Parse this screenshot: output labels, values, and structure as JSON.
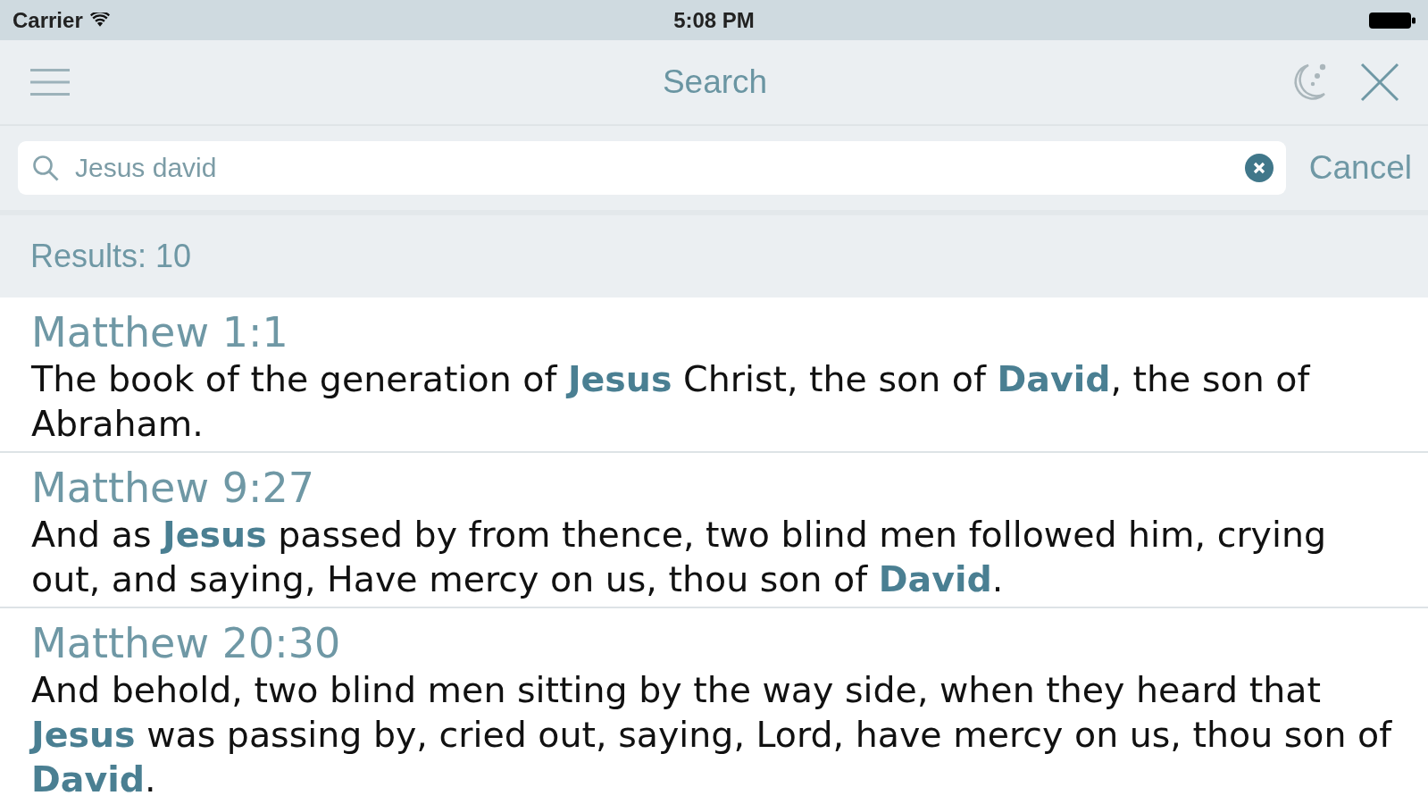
{
  "status_bar": {
    "carrier": "Carrier",
    "time": "5:08 PM"
  },
  "nav_bar": {
    "title": "Search"
  },
  "search": {
    "value": "Jesus david",
    "cancel": "Cancel"
  },
  "results_header": "Results: 10",
  "results": [
    {
      "reference": "Matthew 1:1",
      "text": "The book of the generation of **Jesus** Christ, the son of **David**, the son of Abraham."
    },
    {
      "reference": "Matthew 9:27",
      "text": "And as **Jesus** passed by from thence, two blind men followed him, crying out, and saying, Have mercy on us, thou son of **David**."
    },
    {
      "reference": "Matthew 20:30",
      "text": "And behold, two blind men sitting by the way side, when they heard that **Jesus** was passing by, cried out, saying, Lord, have mercy on us, thou son of **David**."
    }
  ]
}
